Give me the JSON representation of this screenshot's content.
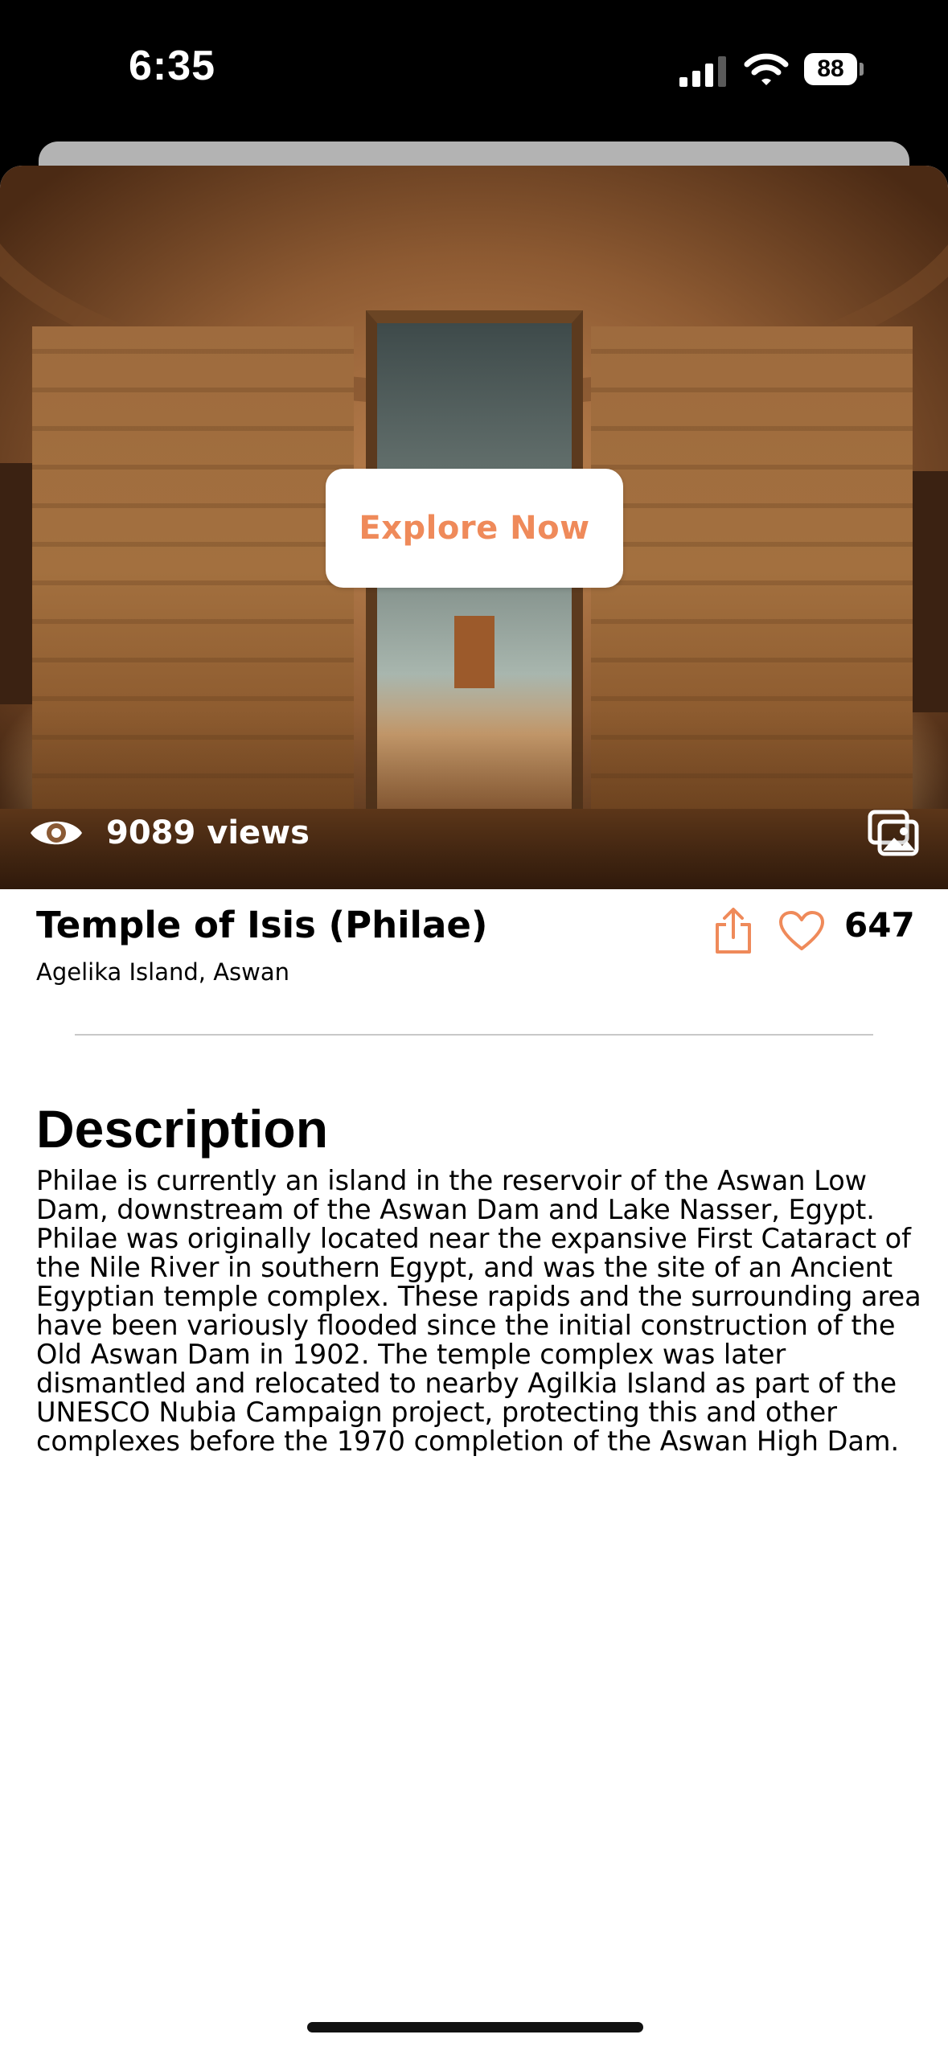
{
  "status_bar": {
    "time": "6:35",
    "battery": "88"
  },
  "hero": {
    "explore_label": "Explore Now",
    "views_text": "9089 views"
  },
  "place": {
    "title": "Temple of Isis (Philae)",
    "location": "Agelika Island, Aswan",
    "likes": "647"
  },
  "description": {
    "heading": "Description",
    "body": "Philae is currently an island in the reservoir of the Aswan Low Dam, downstream of the Aswan Dam and Lake Nasser, Egypt. Philae was originally located near the expansive First Cataract of the Nile River in southern Egypt, and was the site of an Ancient Egyptian temple complex. These rapids and the surrounding area have been variously flooded since the initial construction of the Old Aswan Dam in 1902. The temple complex was later dismantled and relocated to nearby Agilkia Island as part of the UNESCO Nubia Campaign project, protecting this and other complexes before the 1970 completion of the Aswan High Dam."
  },
  "colors": {
    "accent": "#ef8a5a",
    "text": "#000000"
  },
  "icons": [
    "signal-icon",
    "wifi-icon",
    "battery-icon",
    "eye-icon",
    "gallery-icon",
    "share-icon",
    "heart-icon"
  ]
}
